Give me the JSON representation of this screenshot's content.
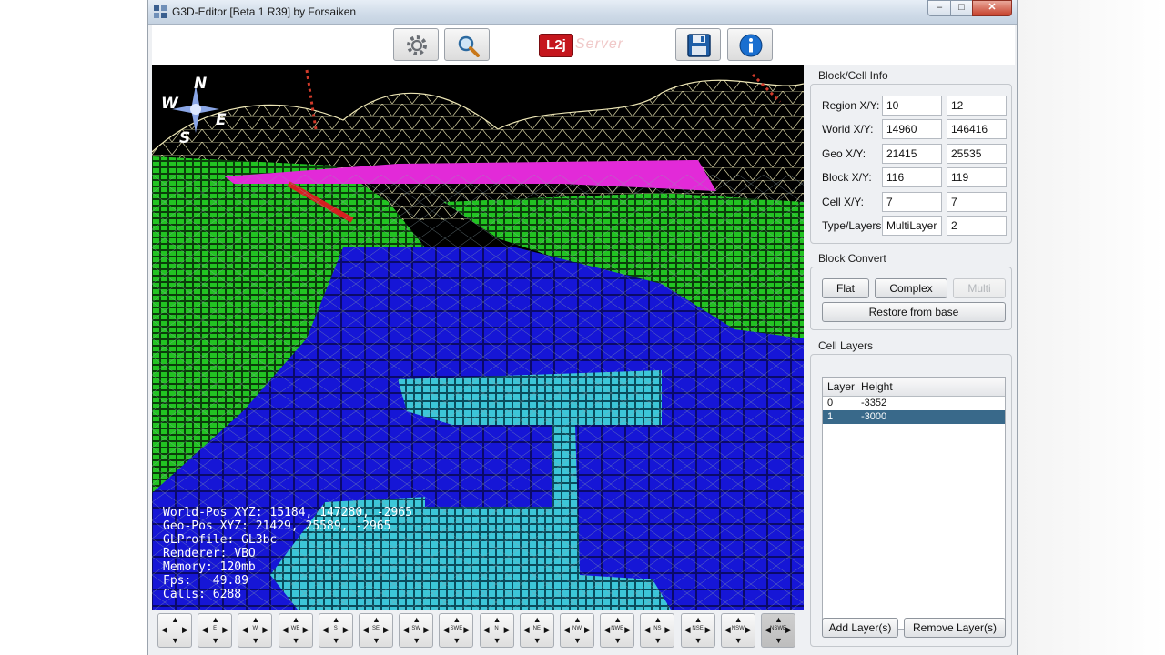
{
  "window": {
    "title": "G3D-Editor [Beta 1 R39] by Forsaiken",
    "min_glyph": "‒",
    "max_glyph": "□",
    "close_glyph": "✕"
  },
  "toolbar": {
    "settings_icon": "gear-icon",
    "search_icon": "magnifier-icon",
    "logo_box": "L2j",
    "logo_text": "Server",
    "save_icon": "floppy-disk-icon",
    "info_icon": "info-icon"
  },
  "compass": {
    "n": "N",
    "w": "W",
    "e": "E",
    "s": "S"
  },
  "overlay": {
    "world_pos": "World-Pos XYZ: 15184, 147280, -2965",
    "geo_pos": "Geo-Pos XYZ: 21429, 25589, -2965",
    "gl_profile": "GLProfile: GL3bc",
    "renderer": "Renderer: VBO",
    "memory": "Memory: 120mb",
    "fps": "Fps:   49.89",
    "calls": "Calls: 6288"
  },
  "nav_buttons": [
    "",
    "E",
    "W",
    "WE",
    "S",
    "SE",
    "SW",
    "SWE",
    "N",
    "NE",
    "NW",
    "NWE",
    "NS",
    "NSE",
    "NSW",
    "NSWE"
  ],
  "block_info": {
    "title": "Block/Cell Info",
    "rows": [
      {
        "label": "Region X/Y:",
        "a": "10",
        "b": "12"
      },
      {
        "label": "World X/Y:",
        "a": "14960",
        "b": "146416"
      },
      {
        "label": "Geo X/Y:",
        "a": "21415",
        "b": "25535"
      },
      {
        "label": "Block X/Y:",
        "a": "116",
        "b": "119"
      },
      {
        "label": "Cell X/Y:",
        "a": "7",
        "b": "7"
      },
      {
        "label": "Type/Layers:",
        "a": "MultiLayer",
        "b": "2"
      }
    ]
  },
  "block_convert": {
    "title": "Block Convert",
    "flat": "Flat",
    "complex": "Complex",
    "multi": "Multi",
    "restore": "Restore from base"
  },
  "cell_layers": {
    "title": "Cell Layers",
    "col_layer": "Layer",
    "col_height": "Height",
    "rows": [
      {
        "layer": "0",
        "height": "-3352"
      },
      {
        "layer": "1",
        "height": "-3000"
      }
    ],
    "add": "Add Layer(s)",
    "remove": "Remove Layer(s)"
  },
  "colors": {
    "blue_tiles": "#1414d8",
    "green_tiles": "#1fbf1f",
    "cyan_tiles": "#33c4d6",
    "magenta": "#e22ad8",
    "selection": "#39698a"
  }
}
